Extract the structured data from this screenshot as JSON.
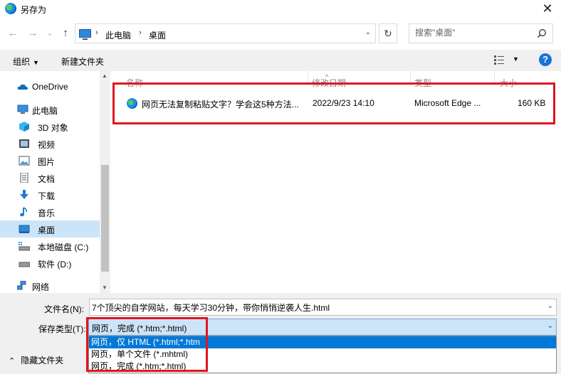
{
  "window": {
    "title": "另存为",
    "close_symbol": "✕"
  },
  "nav": {
    "back_symbol": "←",
    "forward_symbol": "→",
    "history_symbol": "⌄",
    "up_symbol": "↑",
    "breadcrumbs": [
      "此电脑",
      "桌面"
    ],
    "breadcrumb_separator": "›",
    "dropdown_symbol": "⌄",
    "refresh_symbol": "↻",
    "search_placeholder": "搜索\"桌面\""
  },
  "toolbar": {
    "organize_label": "组织",
    "caret_symbol": "▼",
    "new_folder_label": "新建文件夹",
    "help_symbol": "?"
  },
  "sidebar": {
    "items": [
      {
        "label": "OneDrive",
        "icon": "onedrive-icon",
        "level": "top"
      },
      {
        "label": "此电脑",
        "icon": "computer-icon",
        "level": "top"
      },
      {
        "label": "3D 对象",
        "icon": "3d-objects-icon",
        "level": "sub"
      },
      {
        "label": "视频",
        "icon": "video-folder-icon",
        "level": "sub"
      },
      {
        "label": "图片",
        "icon": "pictures-folder-icon",
        "level": "sub"
      },
      {
        "label": "文档",
        "icon": "documents-folder-icon",
        "level": "sub"
      },
      {
        "label": "下载",
        "icon": "downloads-folder-icon",
        "level": "sub"
      },
      {
        "label": "音乐",
        "icon": "music-folder-icon",
        "level": "sub"
      },
      {
        "label": "桌面",
        "icon": "desktop-folder-icon",
        "level": "sub",
        "selected": true
      },
      {
        "label": "本地磁盘 (C:)",
        "icon": "local-disk-icon",
        "level": "sub"
      },
      {
        "label": "软件 (D:)",
        "icon": "drive-icon",
        "level": "sub"
      },
      {
        "label": "网络",
        "icon": "network-icon",
        "level": "top"
      }
    ]
  },
  "file_list": {
    "columns": [
      "名称",
      "修改日期",
      "类型",
      "大小"
    ],
    "sort_symbol": "^",
    "rows": [
      {
        "name": "网页无法复制粘贴文字？学会这5种方法...",
        "modified": "2022/9/23 14:10",
        "type": "Microsoft Edge ...",
        "size": "160 KB",
        "icon": "edge-file-icon"
      }
    ]
  },
  "save_form": {
    "filename_label": "文件名(N):",
    "filename_value": "7个顶尖的自学网站，每天学习30分钟，带你悄悄逆袭人生.html",
    "filetype_label": "保存类型(T):",
    "filetype_value": "网页，完成 (*.htm;*.html)",
    "filetype_options": [
      {
        "label": "网页，仅 HTML (*.html;*.htm",
        "selected": true
      },
      {
        "label": "网页，单个文件 (*.mhtml)",
        "selected": false
      },
      {
        "label": "网页，完成 (*.htm;*.html)",
        "selected": false
      }
    ],
    "dropdown_symbol": "⌄",
    "hide_folders_label": "隐藏文件夹",
    "hide_folders_symbol": "⌃"
  },
  "colors": {
    "highlight_box": "#e0161d",
    "selection": "#0078d7",
    "nav_selected": "#cce4f7"
  }
}
